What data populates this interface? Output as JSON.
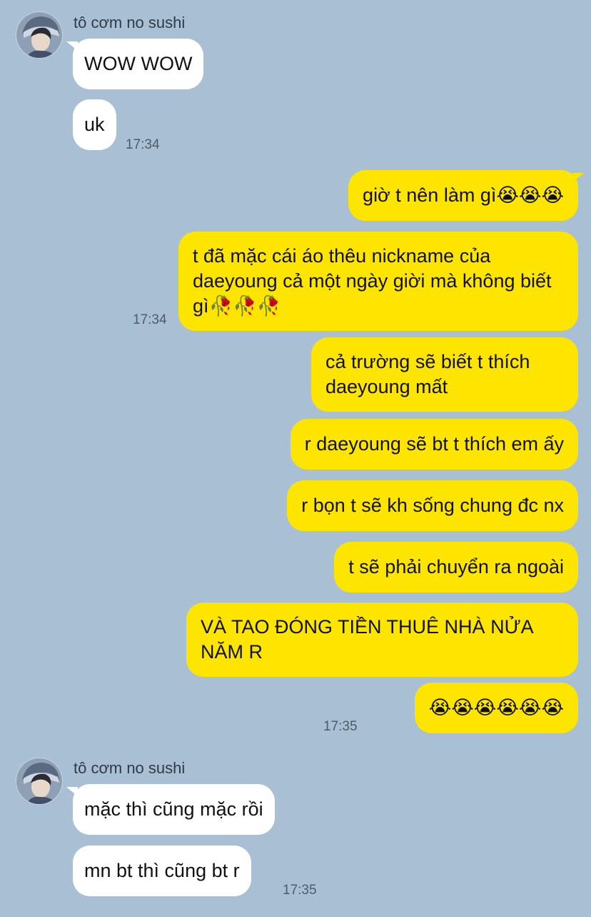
{
  "chat": {
    "messages": [
      {
        "id": 1,
        "sender": "tô cơm no sushi",
        "side": "in",
        "text": "WOW WOW"
      },
      {
        "id": 2,
        "side": "in",
        "text": "uk",
        "time": "17:34"
      },
      {
        "id": 3,
        "side": "out",
        "text": "giờ t nên làm gì😭😭😭"
      },
      {
        "id": 4,
        "side": "out",
        "text": "t đã mặc cái áo thêu nickname của daeyoung cả một ngày giời mà không biết gì🥀🥀🥀",
        "time": "17:34"
      },
      {
        "id": 5,
        "side": "out",
        "text": "cả trường sẽ biết t thích daeyoung mất"
      },
      {
        "id": 6,
        "side": "out",
        "text": "r daeyoung sẽ bt t thích em ấy"
      },
      {
        "id": 7,
        "side": "out",
        "text": "r bọn t sẽ kh sống chung đc nx"
      },
      {
        "id": 8,
        "side": "out",
        "text": "t sẽ phải chuyển ra ngoài"
      },
      {
        "id": 9,
        "side": "out",
        "text": "VÀ TAO ĐÓNG TIỀN THUÊ NHÀ NỬA NĂM R"
      },
      {
        "id": 10,
        "side": "out",
        "text": "😭😭😭😭😭😭",
        "time": "17:35"
      },
      {
        "id": 11,
        "sender": "tô cơm no sushi",
        "side": "in",
        "text": "mặc thì cũng mặc rồi"
      },
      {
        "id": 12,
        "side": "in",
        "text": "mn bt thì cũng bt r",
        "time": "17:35"
      }
    ]
  },
  "colors": {
    "background": "#a9bfd3",
    "incoming_bubble": "#ffffff",
    "outgoing_bubble": "#fee500"
  },
  "icons": {
    "avatar": "contact-avatar-photo"
  }
}
